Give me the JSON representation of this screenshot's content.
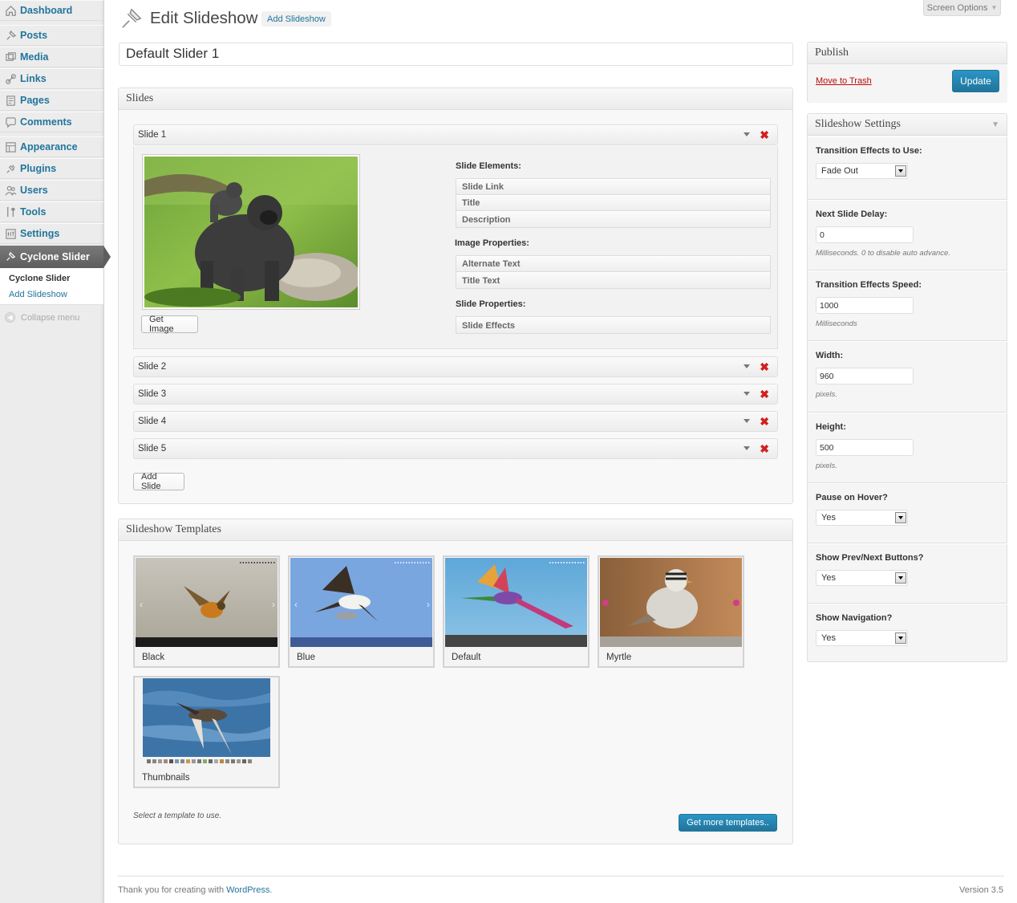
{
  "menu": {
    "items": [
      {
        "label": "Dashboard",
        "icon": "dashboard-icon"
      },
      {
        "label": "Posts",
        "icon": "pushpin-icon"
      },
      {
        "label": "Media",
        "icon": "media-icon"
      },
      {
        "label": "Links",
        "icon": "link-icon"
      },
      {
        "label": "Pages",
        "icon": "page-icon"
      },
      {
        "label": "Comments",
        "icon": "comment-icon"
      },
      {
        "label": "Appearance",
        "icon": "appearance-icon"
      },
      {
        "label": "Plugins",
        "icon": "plug-icon"
      },
      {
        "label": "Users",
        "icon": "users-icon"
      },
      {
        "label": "Tools",
        "icon": "tools-icon"
      },
      {
        "label": "Settings",
        "icon": "settings-icon"
      }
    ],
    "active": {
      "label": "Cyclone Slider",
      "icon": "pushpin-icon"
    },
    "submenu": {
      "current": "Cyclone Slider",
      "add": "Add Slideshow"
    },
    "collapse": "Collapse menu"
  },
  "header": {
    "screen_options": "Screen Options",
    "title": "Edit Slideshow",
    "add_new": "Add Slideshow",
    "slideshow_name": "Default Slider 1"
  },
  "slides": {
    "box_title": "Slides",
    "items": [
      "Slide 1",
      "Slide 2",
      "Slide 3",
      "Slide 4",
      "Slide 5"
    ],
    "get_image": "Get Image",
    "add_slide": "Add Slide",
    "slide_elements_label": "Slide Elements:",
    "slide_elements": [
      "Slide Link",
      "Title",
      "Description"
    ],
    "image_properties_label": "Image Properties:",
    "image_properties": [
      "Alternate Text",
      "Title Text"
    ],
    "slide_properties_label": "Slide Properties:",
    "slide_properties": [
      "Slide Effects"
    ]
  },
  "templates": {
    "box_title": "Slideshow Templates",
    "items": [
      "Black",
      "Blue",
      "Default",
      "Myrtle",
      "Thumbnails"
    ],
    "note": "Select a template to use.",
    "more": "Get more templates.."
  },
  "publish": {
    "title": "Publish",
    "trash": "Move to Trash",
    "update": "Update"
  },
  "settings": {
    "title": "Slideshow Settings",
    "transition_label": "Transition Effects to Use:",
    "transition_value": "Fade Out",
    "delay_label": "Next Slide Delay:",
    "delay_value": "0",
    "delay_hint": "Milliseconds. 0 to disable auto advance.",
    "speed_label": "Transition Effects Speed:",
    "speed_value": "1000",
    "speed_hint": "Milliseconds",
    "width_label": "Width:",
    "width_value": "960",
    "width_hint": "pixels.",
    "height_label": "Height:",
    "height_value": "500",
    "height_hint": "pixels.",
    "pause_label": "Pause on Hover?",
    "pause_value": "Yes",
    "buttons_label": "Show Prev/Next Buttons?",
    "buttons_value": "Yes",
    "nav_label": "Show Navigation?",
    "nav_value": "Yes"
  },
  "footer": {
    "thanks": "Thank you for creating with ",
    "wp_link": "WordPress",
    "period": ".",
    "version": "Version 3.5"
  },
  "colors": {
    "link": "#21759b",
    "delete": "#d21f1f",
    "primary_button": "#2a95c5"
  }
}
